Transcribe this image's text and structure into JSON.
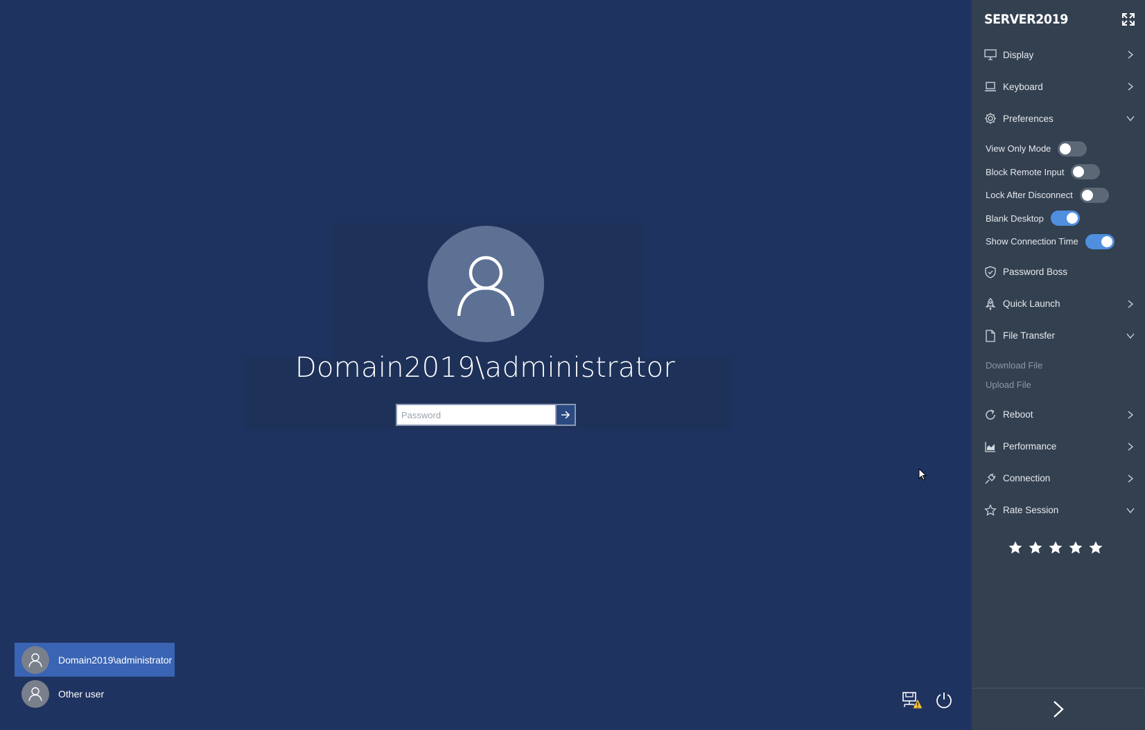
{
  "login": {
    "username": "Domain2019\\administrator",
    "password_placeholder": "Password",
    "users": [
      {
        "name": "Domain2019\\administrator",
        "selected": true
      },
      {
        "name": "Other user",
        "selected": false
      }
    ]
  },
  "panel": {
    "title": "SERVER2019",
    "menu_top": [
      {
        "label": "Display",
        "icon": "monitor-icon",
        "chevron": "right"
      },
      {
        "label": "Keyboard",
        "icon": "laptop-icon",
        "chevron": "right"
      },
      {
        "label": "Preferences",
        "icon": "gear-icon",
        "chevron": "down"
      }
    ],
    "preferences": [
      {
        "label": "View Only Mode",
        "on": false
      },
      {
        "label": "Block Remote Input",
        "on": false
      },
      {
        "label": "Lock After Disconnect",
        "on": false
      },
      {
        "label": "Blank Desktop",
        "on": true
      },
      {
        "label": "Show Connection Time",
        "on": true
      }
    ],
    "menu_mid": [
      {
        "label": "Password Boss",
        "icon": "shield-icon",
        "chevron": ""
      },
      {
        "label": "Quick Launch",
        "icon": "rocket-icon",
        "chevron": "right"
      },
      {
        "label": "File Transfer",
        "icon": "file-icon",
        "chevron": "down"
      }
    ],
    "file_transfer": [
      "Download File",
      "Upload File"
    ],
    "menu_bottom": [
      {
        "label": "Reboot",
        "icon": "refresh-icon",
        "chevron": "right"
      },
      {
        "label": "Performance",
        "icon": "chart-icon",
        "chevron": "right"
      },
      {
        "label": "Connection",
        "icon": "plug-icon",
        "chevron": "right"
      },
      {
        "label": "Rate Session",
        "icon": "star-outline-icon",
        "chevron": "down"
      }
    ],
    "rating": {
      "max": 5
    }
  },
  "colors": {
    "background": "#1f3360",
    "panel": "#334050",
    "toggle_on": "#4f8fde",
    "selected_user": "#3a64b4"
  }
}
